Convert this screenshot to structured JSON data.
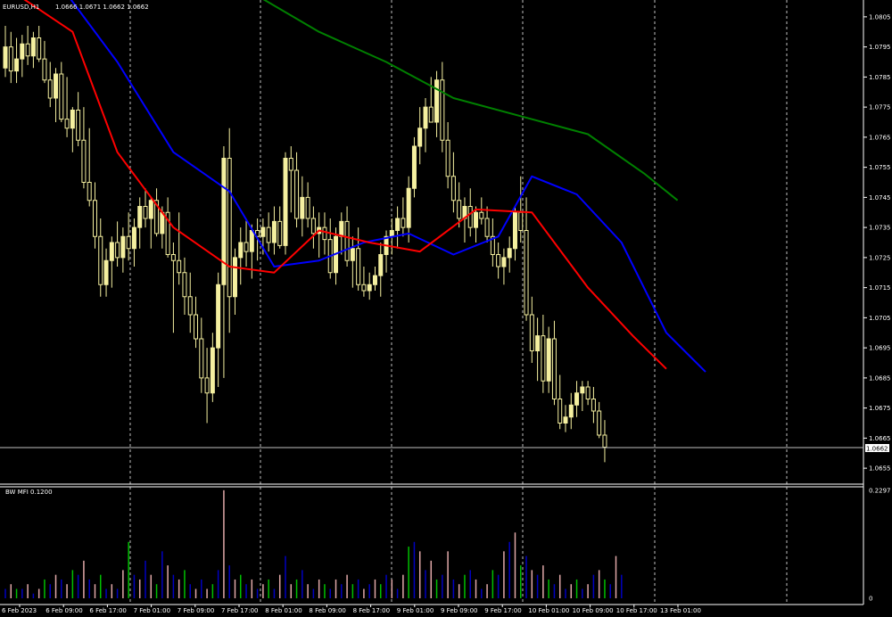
{
  "header": {
    "symbol": "EURUSD,H1",
    "ohlc": "1.0666 1.0671 1.0662 1.0662"
  },
  "indicator": {
    "label": "BW MFI 0.1200"
  },
  "price_axis": {
    "ticks": [
      "1.0805",
      "1.0795",
      "1.0785",
      "1.0775",
      "1.0765",
      "1.0755",
      "1.0745",
      "1.0735",
      "1.0725",
      "1.0715",
      "1.0705",
      "1.0695",
      "1.0685",
      "1.0675",
      "1.0665",
      "1.0655"
    ],
    "current_price": "1.0662"
  },
  "mfi_axis": {
    "ticks": [
      "0.2297",
      "0"
    ]
  },
  "time_axis": {
    "ticks": [
      "6 Feb 2023",
      "6 Feb 09:00",
      "6 Feb 17:00",
      "7 Feb 01:00",
      "7 Feb 09:00",
      "7 Feb 17:00",
      "8 Feb 01:00",
      "8 Feb 09:00",
      "8 Feb 17:00",
      "9 Feb 01:00",
      "9 Feb 09:00",
      "9 Feb 17:00",
      "10 Feb 01:00",
      "10 Feb 09:00",
      "10 Feb 17:00",
      "13 Feb 01:00"
    ]
  },
  "colors": {
    "background": "#000000",
    "bull_candle": "#f5f0a0",
    "bear_candle": "#000000",
    "wick": "#f5f0a0",
    "ma_fast": "#ff0000",
    "ma_mid": "#0000ff",
    "ma_slow": "#008000",
    "grid": "#c0c0c0",
    "mfi_green": "#00c000",
    "mfi_blue": "#0000c0",
    "mfi_pink": "#e0a8a8"
  },
  "chart_data": {
    "type": "candlestick",
    "title": "EURUSD,H1",
    "y_range": [
      1.065,
      1.081
    ],
    "candles": [
      [
        1.0788,
        1.0802,
        1.0785,
        1.0795
      ],
      [
        1.0795,
        1.08,
        1.0783,
        1.0787
      ],
      [
        1.0787,
        1.0798,
        1.0783,
        1.0791
      ],
      [
        1.0791,
        1.0799,
        1.0785,
        1.0796
      ],
      [
        1.0796,
        1.0802,
        1.0789,
        1.0792
      ],
      [
        1.0792,
        1.08,
        1.0788,
        1.0798
      ],
      [
        1.0798,
        1.0802,
        1.079,
        1.0791
      ],
      [
        1.0791,
        1.0797,
        1.0783,
        1.0784
      ],
      [
        1.0784,
        1.079,
        1.0775,
        1.0778
      ],
      [
        1.0778,
        1.0788,
        1.077,
        1.0786
      ],
      [
        1.0786,
        1.079,
        1.077,
        1.0771
      ],
      [
        1.0771,
        1.0785,
        1.0765,
        1.0768
      ],
      [
        1.0768,
        1.0775,
        1.076,
        1.0774
      ],
      [
        1.0774,
        1.078,
        1.0762,
        1.0764
      ],
      [
        1.0764,
        1.0775,
        1.0748,
        1.075
      ],
      [
        1.075,
        1.0768,
        1.0742,
        1.0744
      ],
      [
        1.0744,
        1.075,
        1.0728,
        1.0732
      ],
      [
        1.0732,
        1.0738,
        1.0712,
        1.0716
      ],
      [
        1.0716,
        1.0728,
        1.0712,
        1.0724
      ],
      [
        1.0724,
        1.0732,
        1.0715,
        1.073
      ],
      [
        1.073,
        1.0737,
        1.0722,
        1.0725
      ],
      [
        1.0725,
        1.0735,
        1.072,
        1.0732
      ],
      [
        1.0732,
        1.074,
        1.0724,
        1.0728
      ],
      [
        1.0728,
        1.0738,
        1.0722,
        1.0735
      ],
      [
        1.0735,
        1.0745,
        1.0728,
        1.0742
      ],
      [
        1.0742,
        1.0748,
        1.0735,
        1.0738
      ],
      [
        1.0738,
        1.0745,
        1.0728,
        1.0744
      ],
      [
        1.0744,
        1.0748,
        1.0732,
        1.0733
      ],
      [
        1.0733,
        1.0742,
        1.0728,
        1.074
      ],
      [
        1.074,
        1.0745,
        1.0725,
        1.0726
      ],
      [
        1.0726,
        1.073,
        1.07,
        1.0724
      ],
      [
        1.0724,
        1.074,
        1.0716,
        1.072
      ],
      [
        1.072,
        1.0725,
        1.0706,
        1.0712
      ],
      [
        1.0712,
        1.072,
        1.07,
        1.0706
      ],
      [
        1.0706,
        1.0712,
        1.0695,
        1.0698
      ],
      [
        1.0698,
        1.0705,
        1.068,
        1.0685
      ],
      [
        1.0685,
        1.0695,
        1.067,
        1.068
      ],
      [
        1.068,
        1.07,
        1.0677,
        1.0695
      ],
      [
        1.0695,
        1.072,
        1.0682,
        1.0716
      ],
      [
        1.0716,
        1.0762,
        1.0685,
        1.0758
      ],
      [
        1.0758,
        1.0768,
        1.07,
        1.0712
      ],
      [
        1.0712,
        1.0728,
        1.0706,
        1.0725
      ],
      [
        1.0725,
        1.0735,
        1.0716,
        1.073
      ],
      [
        1.073,
        1.0738,
        1.0722,
        1.0727
      ],
      [
        1.0727,
        1.0736,
        1.0718,
        1.0734
      ],
      [
        1.0734,
        1.0738,
        1.0724,
        1.0732
      ],
      [
        1.0732,
        1.0738,
        1.0726,
        1.0735
      ],
      [
        1.0735,
        1.074,
        1.0727,
        1.073
      ],
      [
        1.073,
        1.0742,
        1.0726,
        1.0737
      ],
      [
        1.0737,
        1.0742,
        1.0728,
        1.0729
      ],
      [
        1.0729,
        1.076,
        1.0726,
        1.0758
      ],
      [
        1.0758,
        1.0762,
        1.074,
        1.0754
      ],
      [
        1.0754,
        1.076,
        1.0735,
        1.0738
      ],
      [
        1.0738,
        1.0752,
        1.0732,
        1.0745
      ],
      [
        1.0745,
        1.075,
        1.0735,
        1.0738
      ],
      [
        1.0738,
        1.0742,
        1.0728,
        1.0733
      ],
      [
        1.0733,
        1.074,
        1.0725,
        1.0735
      ],
      [
        1.0735,
        1.074,
        1.0726,
        1.0731
      ],
      [
        1.0731,
        1.0738,
        1.0718,
        1.072
      ],
      [
        1.072,
        1.0735,
        1.0716,
        1.0732
      ],
      [
        1.0732,
        1.074,
        1.0726,
        1.0737
      ],
      [
        1.0737,
        1.0742,
        1.0722,
        1.0724
      ],
      [
        1.0724,
        1.0732,
        1.0715,
        1.0728
      ],
      [
        1.0728,
        1.0735,
        1.0714,
        1.0716
      ],
      [
        1.0716,
        1.0722,
        1.0712,
        1.0714
      ],
      [
        1.0714,
        1.072,
        1.0711,
        1.0716
      ],
      [
        1.0716,
        1.0722,
        1.0714,
        1.0719
      ],
      [
        1.0719,
        1.073,
        1.0712,
        1.0726
      ],
      [
        1.0726,
        1.0734,
        1.072,
        1.0732
      ],
      [
        1.0732,
        1.0738,
        1.0726,
        1.0734
      ],
      [
        1.0734,
        1.0742,
        1.0728,
        1.0738
      ],
      [
        1.0738,
        1.0745,
        1.0732,
        1.0735
      ],
      [
        1.0735,
        1.0752,
        1.073,
        1.0748
      ],
      [
        1.0748,
        1.0765,
        1.0745,
        1.0762
      ],
      [
        1.0762,
        1.0775,
        1.0756,
        1.0768
      ],
      [
        1.0768,
        1.0778,
        1.076,
        1.0775
      ],
      [
        1.0775,
        1.0785,
        1.077,
        1.077
      ],
      [
        1.077,
        1.0787,
        1.0765,
        1.0784
      ],
      [
        1.0784,
        1.079,
        1.076,
        1.0764
      ],
      [
        1.0764,
        1.077,
        1.0748,
        1.0752
      ],
      [
        1.0752,
        1.076,
        1.074,
        1.0744
      ],
      [
        1.0744,
        1.075,
        1.0735,
        1.0738
      ],
      [
        1.0738,
        1.0745,
        1.073,
        1.0742
      ],
      [
        1.0742,
        1.0748,
        1.0732,
        1.0735
      ],
      [
        1.0735,
        1.0742,
        1.073,
        1.074
      ],
      [
        1.074,
        1.0745,
        1.0736,
        1.0738
      ],
      [
        1.0738,
        1.0742,
        1.073,
        1.0732
      ],
      [
        1.0732,
        1.0738,
        1.0722,
        1.0726
      ],
      [
        1.0726,
        1.073,
        1.0718,
        1.0722
      ],
      [
        1.0722,
        1.0728,
        1.0716,
        1.0725
      ],
      [
        1.0725,
        1.0732,
        1.072,
        1.0728
      ],
      [
        1.0728,
        1.0742,
        1.0724,
        1.074
      ],
      [
        1.074,
        1.0752,
        1.073,
        1.0734
      ],
      [
        1.0734,
        1.0745,
        1.0704,
        1.0706
      ],
      [
        1.0706,
        1.0712,
        1.069,
        1.0694
      ],
      [
        1.0694,
        1.0705,
        1.0684,
        1.0699
      ],
      [
        1.0699,
        1.0706,
        1.068,
        1.0684
      ],
      [
        1.0684,
        1.0702,
        1.068,
        1.0698
      ],
      [
        1.0698,
        1.0704,
        1.0676,
        1.0678
      ],
      [
        1.0678,
        1.0686,
        1.0668,
        1.067
      ],
      [
        1.067,
        1.0676,
        1.0667,
        1.0672
      ],
      [
        1.0672,
        1.068,
        1.0668,
        1.0676
      ],
      [
        1.0676,
        1.0684,
        1.0672,
        1.068
      ],
      [
        1.068,
        1.0684,
        1.0674,
        1.0682
      ],
      [
        1.0682,
        1.0684,
        1.0676,
        1.0678
      ],
      [
        1.0678,
        1.0682,
        1.067,
        1.0674
      ],
      [
        1.0674,
        1.0677,
        1.0665,
        1.0666
      ],
      [
        1.0666,
        1.0671,
        1.0657,
        1.0662
      ]
    ],
    "ma_fast": [
      [
        0,
        1.0815
      ],
      [
        12,
        1.08
      ],
      [
        20,
        1.076
      ],
      [
        30,
        1.0735
      ],
      [
        40,
        1.0722
      ],
      [
        48,
        1.072
      ],
      [
        56,
        1.0734
      ],
      [
        65,
        1.073
      ],
      [
        74,
        1.0727
      ],
      [
        84,
        1.0741
      ],
      [
        94,
        1.074
      ],
      [
        104,
        1.0715
      ],
      [
        112,
        1.0699
      ],
      [
        118,
        1.0688
      ]
    ],
    "ma_mid": [
      [
        10,
        1.0815
      ],
      [
        20,
        1.079
      ],
      [
        30,
        1.076
      ],
      [
        40,
        1.0747
      ],
      [
        48,
        1.0722
      ],
      [
        56,
        1.0724
      ],
      [
        64,
        1.073
      ],
      [
        72,
        1.0733
      ],
      [
        80,
        1.0726
      ],
      [
        88,
        1.0732
      ],
      [
        94,
        1.0752
      ],
      [
        102,
        1.0746
      ],
      [
        110,
        1.073
      ],
      [
        118,
        1.07
      ],
      [
        125,
        1.0687
      ]
    ],
    "ma_slow": [
      [
        45,
        1.0812
      ],
      [
        56,
        1.08
      ],
      [
        68,
        1.079
      ],
      [
        80,
        1.0778
      ],
      [
        92,
        1.0772
      ],
      [
        104,
        1.0766
      ],
      [
        114,
        1.0753
      ],
      [
        120,
        1.0744
      ]
    ],
    "mfi": [
      0.02,
      0.03,
      0.02,
      0.02,
      0.03,
      0.01,
      0.02,
      0.04,
      0.03,
      0.05,
      0.04,
      0.03,
      0.06,
      0.05,
      0.08,
      0.04,
      0.03,
      0.05,
      0.02,
      0.03,
      0.02,
      0.06,
      0.12,
      0.05,
      0.04,
      0.08,
      0.05,
      0.03,
      0.1,
      0.07,
      0.05,
      0.04,
      0.06,
      0.03,
      0.02,
      0.04,
      0.02,
      0.03,
      0.06,
      0.23,
      0.07,
      0.04,
      0.05,
      0.03,
      0.04,
      0.02,
      0.03,
      0.04,
      0.02,
      0.05,
      0.09,
      0.03,
      0.04,
      0.06,
      0.03,
      0.02,
      0.04,
      0.03,
      0.02,
      0.04,
      0.03,
      0.05,
      0.03,
      0.04,
      0.02,
      0.03,
      0.04,
      0.03,
      0.05,
      0.04,
      0.02,
      0.05,
      0.11,
      0.12,
      0.1,
      0.06,
      0.08,
      0.04,
      0.05,
      0.1,
      0.04,
      0.03,
      0.05,
      0.06,
      0.04,
      0.02,
      0.03,
      0.06,
      0.05,
      0.1,
      0.12,
      0.14,
      0.07,
      0.09,
      0.06,
      0.05,
      0.07,
      0.04,
      0.03,
      0.05,
      0.02,
      0.03,
      0.04,
      0.02,
      0.03,
      0.05,
      0.06,
      0.04,
      0.03,
      0.09,
      0.05
    ],
    "mfi_max": 0.2297
  }
}
